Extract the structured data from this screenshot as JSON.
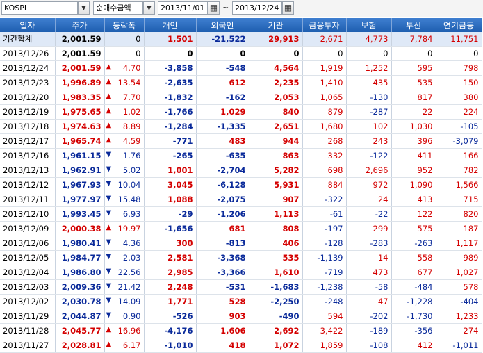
{
  "toolbar": {
    "market": "KOSPI",
    "metric": "순매수금액",
    "date_from": "2013/11/01",
    "date_to": "2013/12/24",
    "separator": "~"
  },
  "columns": [
    "일자",
    "주가",
    "등락폭",
    "개인",
    "외국인",
    "기관",
    "금융투자",
    "보험",
    "투신",
    "연기금등"
  ],
  "colors": {
    "up": "#d40000",
    "down": "#0a2a9a",
    "header": "#2a6ac0",
    "summary_bg": "#dfe9f7"
  },
  "rows": [
    {
      "date": "기간합계",
      "price": "2,001.59",
      "chg": "0",
      "dir": "none",
      "ind": "1,501",
      "for": "-21,522",
      "inst": "29,913",
      "fin": "2,671",
      "ins": "4,773",
      "trust": "7,784",
      "pen": "11,751",
      "summary": true
    },
    {
      "date": "2013/12/26",
      "price": "2,001.59",
      "chg": "0",
      "dir": "none",
      "ind": "0",
      "for": "0",
      "inst": "0",
      "fin": "0",
      "ins": "0",
      "trust": "0",
      "pen": "0"
    },
    {
      "date": "2013/12/24",
      "price": "2,001.59",
      "chg": "4.70",
      "dir": "up",
      "ind": "-3,858",
      "for": "-548",
      "inst": "4,564",
      "fin": "1,919",
      "ins": "1,252",
      "trust": "595",
      "pen": "798"
    },
    {
      "date": "2013/12/23",
      "price": "1,996.89",
      "chg": "13.54",
      "dir": "up",
      "ind": "-2,635",
      "for": "612",
      "inst": "2,235",
      "fin": "1,410",
      "ins": "435",
      "trust": "535",
      "pen": "150"
    },
    {
      "date": "2013/12/20",
      "price": "1,983.35",
      "chg": "7.70",
      "dir": "up",
      "ind": "-1,832",
      "for": "-162",
      "inst": "2,053",
      "fin": "1,065",
      "ins": "-130",
      "trust": "817",
      "pen": "380"
    },
    {
      "date": "2013/12/19",
      "price": "1,975.65",
      "chg": "1.02",
      "dir": "up",
      "ind": "-1,766",
      "for": "1,029",
      "inst": "840",
      "fin": "879",
      "ins": "-287",
      "trust": "22",
      "pen": "224"
    },
    {
      "date": "2013/12/18",
      "price": "1,974.63",
      "chg": "8.89",
      "dir": "up",
      "ind": "-1,284",
      "for": "-1,335",
      "inst": "2,651",
      "fin": "1,680",
      "ins": "102",
      "trust": "1,030",
      "pen": "-105"
    },
    {
      "date": "2013/12/17",
      "price": "1,965.74",
      "chg": "4.59",
      "dir": "up",
      "ind": "-771",
      "for": "483",
      "inst": "944",
      "fin": "268",
      "ins": "243",
      "trust": "396",
      "pen": "-3,079"
    },
    {
      "date": "2013/12/16",
      "price": "1,961.15",
      "chg": "1.76",
      "dir": "down",
      "ind": "-265",
      "for": "-635",
      "inst": "863",
      "fin": "332",
      "ins": "-122",
      "trust": "411",
      "pen": "166"
    },
    {
      "date": "2013/12/13",
      "price": "1,962.91",
      "chg": "5.02",
      "dir": "down",
      "ind": "1,001",
      "for": "-2,704",
      "inst": "5,282",
      "fin": "698",
      "ins": "2,696",
      "trust": "952",
      "pen": "782"
    },
    {
      "date": "2013/12/12",
      "price": "1,967.93",
      "chg": "10.04",
      "dir": "down",
      "ind": "3,045",
      "for": "-6,128",
      "inst": "5,931",
      "fin": "884",
      "ins": "972",
      "trust": "1,090",
      "pen": "1,566"
    },
    {
      "date": "2013/12/11",
      "price": "1,977.97",
      "chg": "15.48",
      "dir": "down",
      "ind": "1,088",
      "for": "-2,075",
      "inst": "907",
      "fin": "-322",
      "ins": "24",
      "trust": "413",
      "pen": "715"
    },
    {
      "date": "2013/12/10",
      "price": "1,993.45",
      "chg": "6.93",
      "dir": "down",
      "ind": "-29",
      "for": "-1,206",
      "inst": "1,113",
      "fin": "-61",
      "ins": "-22",
      "trust": "122",
      "pen": "820"
    },
    {
      "date": "2013/12/09",
      "price": "2,000.38",
      "chg": "19.97",
      "dir": "up",
      "ind": "-1,656",
      "for": "681",
      "inst": "808",
      "fin": "-197",
      "ins": "299",
      "trust": "575",
      "pen": "187"
    },
    {
      "date": "2013/12/06",
      "price": "1,980.41",
      "chg": "4.36",
      "dir": "down",
      "ind": "300",
      "for": "-813",
      "inst": "406",
      "fin": "-128",
      "ins": "-283",
      "trust": "-263",
      "pen": "1,117"
    },
    {
      "date": "2013/12/05",
      "price": "1,984.77",
      "chg": "2.03",
      "dir": "down",
      "ind": "2,581",
      "for": "-3,368",
      "inst": "535",
      "fin": "-1,139",
      "ins": "14",
      "trust": "558",
      "pen": "989"
    },
    {
      "date": "2013/12/04",
      "price": "1,986.80",
      "chg": "22.56",
      "dir": "down",
      "ind": "2,985",
      "for": "-3,366",
      "inst": "1,610",
      "fin": "-719",
      "ins": "473",
      "trust": "677",
      "pen": "1,027"
    },
    {
      "date": "2013/12/03",
      "price": "2,009.36",
      "chg": "21.42",
      "dir": "down",
      "ind": "2,248",
      "for": "-531",
      "inst": "-1,683",
      "fin": "-1,238",
      "ins": "-58",
      "trust": "-484",
      "pen": "578"
    },
    {
      "date": "2013/12/02",
      "price": "2,030.78",
      "chg": "14.09",
      "dir": "down",
      "ind": "1,771",
      "for": "528",
      "inst": "-2,250",
      "fin": "-248",
      "ins": "47",
      "trust": "-1,228",
      "pen": "-404"
    },
    {
      "date": "2013/11/29",
      "price": "2,044.87",
      "chg": "0.90",
      "dir": "down",
      "ind": "-526",
      "for": "903",
      "inst": "-490",
      "fin": "594",
      "ins": "-202",
      "trust": "-1,730",
      "pen": "1,233"
    },
    {
      "date": "2013/11/28",
      "price": "2,045.77",
      "chg": "16.96",
      "dir": "up",
      "ind": "-4,176",
      "for": "1,606",
      "inst": "2,692",
      "fin": "3,422",
      "ins": "-189",
      "trust": "-356",
      "pen": "274"
    },
    {
      "date": "2013/11/27",
      "price": "2,028.81",
      "chg": "6.17",
      "dir": "up",
      "ind": "-1,010",
      "for": "418",
      "inst": "1,072",
      "fin": "1,859",
      "ins": "-108",
      "trust": "412",
      "pen": "-1,011"
    }
  ]
}
